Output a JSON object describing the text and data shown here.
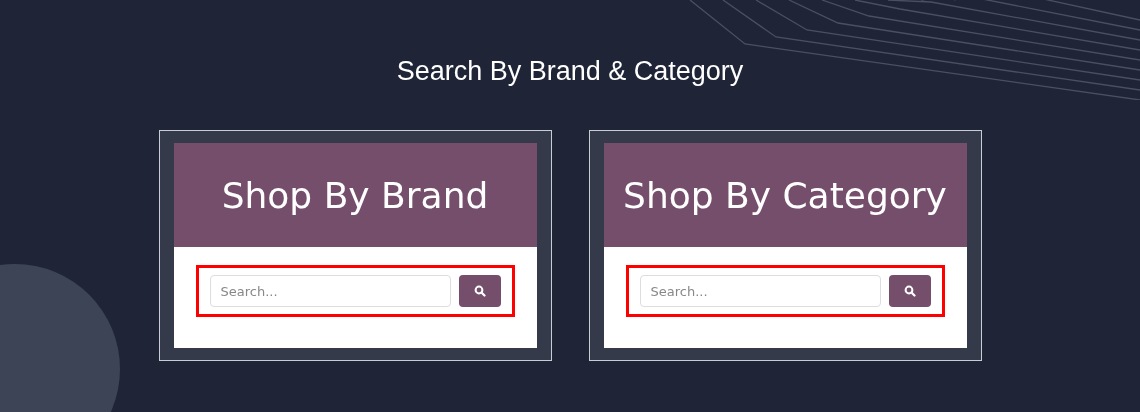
{
  "title": "Search By Brand & Category",
  "cards": [
    {
      "heading": "Shop By Brand",
      "search": {
        "placeholder": "Search..."
      }
    },
    {
      "heading": "Shop By Category",
      "search": {
        "placeholder": "Search..."
      }
    }
  ]
}
